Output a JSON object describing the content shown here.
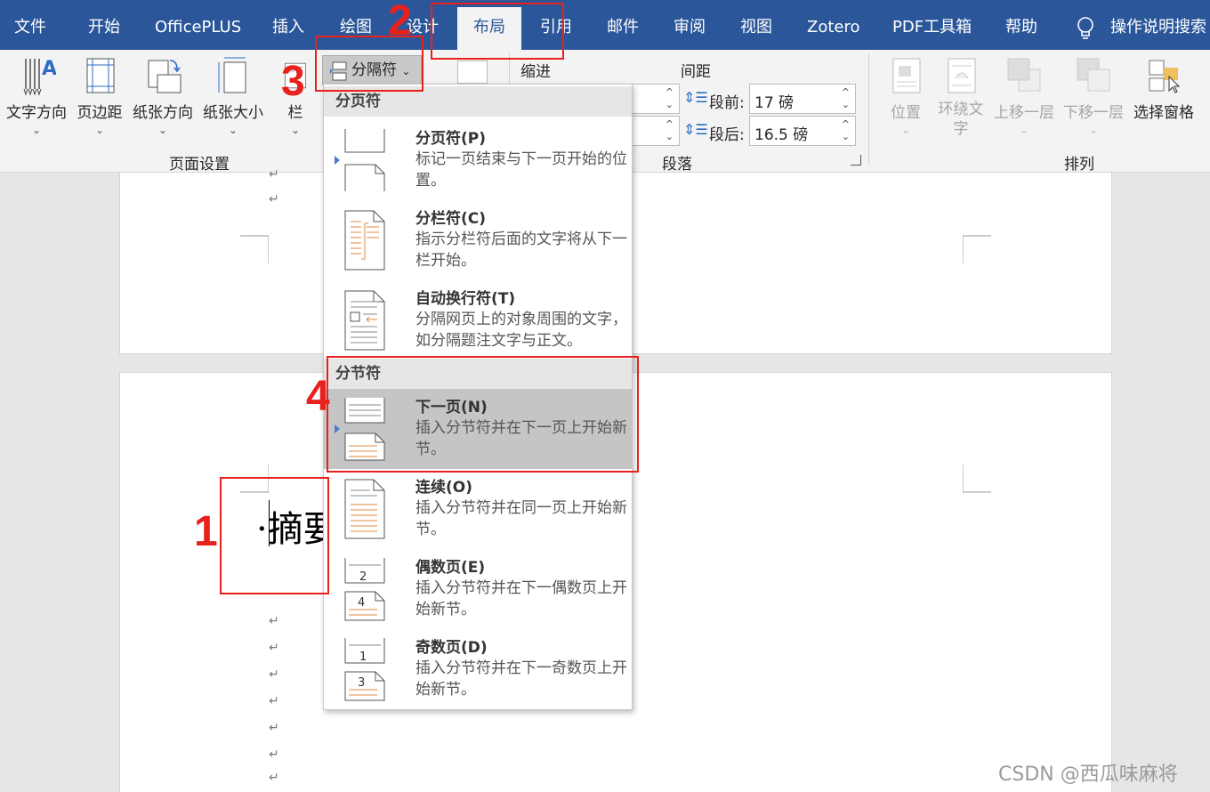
{
  "menubar": {
    "tabs": [
      "文件",
      "开始",
      "OfficePLUS",
      "插入",
      "绘图",
      "设计",
      "布局",
      "引用",
      "邮件",
      "审阅",
      "视图",
      "Zotero",
      "PDF工具箱",
      "帮助"
    ],
    "active_tab": "布局",
    "search_label": "操作说明搜索",
    "colors": {
      "bar": "#2b579a",
      "active_text": "#2b579a"
    }
  },
  "ribbon": {
    "page_setup": {
      "buttons": [
        "文字方向",
        "页边距",
        "纸张方向",
        "纸张大小",
        "栏"
      ],
      "group_label": "页面设置"
    },
    "breaks_button_label": "分隔符",
    "paragraph": {
      "indent_label": "缩进",
      "spacing_label": "间距",
      "before_label": "段前:",
      "before_value": "17 磅",
      "after_label": "段后:",
      "after_value": "16.5 磅",
      "group_label": "段落"
    },
    "arrange": {
      "buttons": [
        "位置",
        "环绕文字",
        "上移一层",
        "下移一层",
        "选择窗格"
      ],
      "group_label": "排列"
    }
  },
  "dropdown": {
    "page_breaks_header": "分页符",
    "section_breaks_header": "分节符",
    "items": [
      {
        "title": "分页符(P)",
        "desc": "标记一页结束与下一页开始的位置。"
      },
      {
        "title": "分栏符(C)",
        "desc": "指示分栏符后面的文字将从下一栏开始。"
      },
      {
        "title": "自动换行符(T)",
        "desc": "分隔网页上的对象周围的文字，如分隔题注文字与正文。"
      },
      {
        "title": "下一页(N)",
        "desc": "插入分节符并在下一页上开始新节。"
      },
      {
        "title": "连续(O)",
        "desc": "插入分节符并在同一页上开始新节。"
      },
      {
        "title": "偶数页(E)",
        "desc": "插入分节符并在下一偶数页上开始新节。"
      },
      {
        "title": "奇数页(D)",
        "desc": "插入分节符并在下一奇数页上开始新节。"
      }
    ],
    "icon_numbers": {
      "even_top": "2",
      "even_bottom": "4",
      "odd_top": "1",
      "odd_bottom": "3"
    }
  },
  "document": {
    "heading_text": "·摘要",
    "paragraph_mark": "↵"
  },
  "annotations": {
    "labels": [
      "1",
      "2",
      "3",
      "4"
    ],
    "color": "#e8211c"
  },
  "watermark": "CSDN @西瓜味麻将"
}
